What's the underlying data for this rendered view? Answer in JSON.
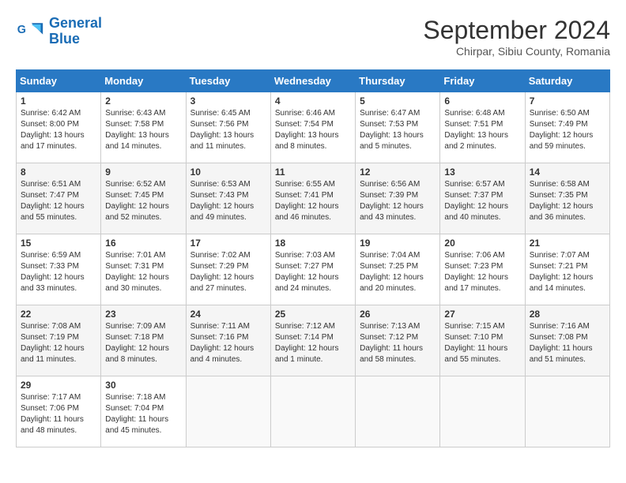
{
  "header": {
    "logo_line1": "General",
    "logo_line2": "Blue",
    "month_title": "September 2024",
    "location": "Chirpar, Sibiu County, Romania"
  },
  "days_of_week": [
    "Sunday",
    "Monday",
    "Tuesday",
    "Wednesday",
    "Thursday",
    "Friday",
    "Saturday"
  ],
  "weeks": [
    [
      {
        "day": "1",
        "sunrise": "6:42 AM",
        "sunset": "8:00 PM",
        "daylight": "13 hours and 17 minutes."
      },
      {
        "day": "2",
        "sunrise": "6:43 AM",
        "sunset": "7:58 PM",
        "daylight": "13 hours and 14 minutes."
      },
      {
        "day": "3",
        "sunrise": "6:45 AM",
        "sunset": "7:56 PM",
        "daylight": "13 hours and 11 minutes."
      },
      {
        "day": "4",
        "sunrise": "6:46 AM",
        "sunset": "7:54 PM",
        "daylight": "13 hours and 8 minutes."
      },
      {
        "day": "5",
        "sunrise": "6:47 AM",
        "sunset": "7:53 PM",
        "daylight": "13 hours and 5 minutes."
      },
      {
        "day": "6",
        "sunrise": "6:48 AM",
        "sunset": "7:51 PM",
        "daylight": "13 hours and 2 minutes."
      },
      {
        "day": "7",
        "sunrise": "6:50 AM",
        "sunset": "7:49 PM",
        "daylight": "12 hours and 59 minutes."
      }
    ],
    [
      {
        "day": "8",
        "sunrise": "6:51 AM",
        "sunset": "7:47 PM",
        "daylight": "12 hours and 55 minutes."
      },
      {
        "day": "9",
        "sunrise": "6:52 AM",
        "sunset": "7:45 PM",
        "daylight": "12 hours and 52 minutes."
      },
      {
        "day": "10",
        "sunrise": "6:53 AM",
        "sunset": "7:43 PM",
        "daylight": "12 hours and 49 minutes."
      },
      {
        "day": "11",
        "sunrise": "6:55 AM",
        "sunset": "7:41 PM",
        "daylight": "12 hours and 46 minutes."
      },
      {
        "day": "12",
        "sunrise": "6:56 AM",
        "sunset": "7:39 PM",
        "daylight": "12 hours and 43 minutes."
      },
      {
        "day": "13",
        "sunrise": "6:57 AM",
        "sunset": "7:37 PM",
        "daylight": "12 hours and 40 minutes."
      },
      {
        "day": "14",
        "sunrise": "6:58 AM",
        "sunset": "7:35 PM",
        "daylight": "12 hours and 36 minutes."
      }
    ],
    [
      {
        "day": "15",
        "sunrise": "6:59 AM",
        "sunset": "7:33 PM",
        "daylight": "12 hours and 33 minutes."
      },
      {
        "day": "16",
        "sunrise": "7:01 AM",
        "sunset": "7:31 PM",
        "daylight": "12 hours and 30 minutes."
      },
      {
        "day": "17",
        "sunrise": "7:02 AM",
        "sunset": "7:29 PM",
        "daylight": "12 hours and 27 minutes."
      },
      {
        "day": "18",
        "sunrise": "7:03 AM",
        "sunset": "7:27 PM",
        "daylight": "12 hours and 24 minutes."
      },
      {
        "day": "19",
        "sunrise": "7:04 AM",
        "sunset": "7:25 PM",
        "daylight": "12 hours and 20 minutes."
      },
      {
        "day": "20",
        "sunrise": "7:06 AM",
        "sunset": "7:23 PM",
        "daylight": "12 hours and 17 minutes."
      },
      {
        "day": "21",
        "sunrise": "7:07 AM",
        "sunset": "7:21 PM",
        "daylight": "12 hours and 14 minutes."
      }
    ],
    [
      {
        "day": "22",
        "sunrise": "7:08 AM",
        "sunset": "7:19 PM",
        "daylight": "12 hours and 11 minutes."
      },
      {
        "day": "23",
        "sunrise": "7:09 AM",
        "sunset": "7:18 PM",
        "daylight": "12 hours and 8 minutes."
      },
      {
        "day": "24",
        "sunrise": "7:11 AM",
        "sunset": "7:16 PM",
        "daylight": "12 hours and 4 minutes."
      },
      {
        "day": "25",
        "sunrise": "7:12 AM",
        "sunset": "7:14 PM",
        "daylight": "12 hours and 1 minute."
      },
      {
        "day": "26",
        "sunrise": "7:13 AM",
        "sunset": "7:12 PM",
        "daylight": "11 hours and 58 minutes."
      },
      {
        "day": "27",
        "sunrise": "7:15 AM",
        "sunset": "7:10 PM",
        "daylight": "11 hours and 55 minutes."
      },
      {
        "day": "28",
        "sunrise": "7:16 AM",
        "sunset": "7:08 PM",
        "daylight": "11 hours and 51 minutes."
      }
    ],
    [
      {
        "day": "29",
        "sunrise": "7:17 AM",
        "sunset": "7:06 PM",
        "daylight": "11 hours and 48 minutes."
      },
      {
        "day": "30",
        "sunrise": "7:18 AM",
        "sunset": "7:04 PM",
        "daylight": "11 hours and 45 minutes."
      },
      null,
      null,
      null,
      null,
      null
    ]
  ]
}
